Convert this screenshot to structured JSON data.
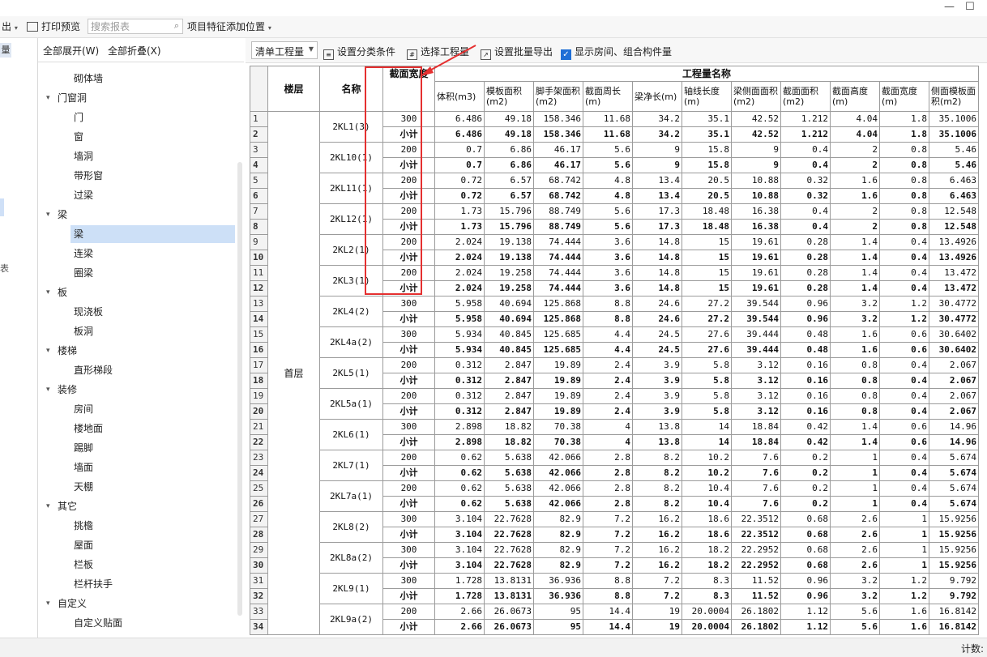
{
  "toolbar": {
    "export_label": "出",
    "print_preview_label": "打印预览",
    "search_placeholder": "搜索报表",
    "feature_position_label": "项目特征添加位置"
  },
  "left_strip": {
    "label": "量",
    "tiny": "表"
  },
  "tree_panel": {
    "expand_all": "全部展开(W)",
    "collapse_all": "全部折叠(X)",
    "items": [
      {
        "label": "砌体墙",
        "level": 2
      },
      {
        "label": "门窗洞",
        "level": 1
      },
      {
        "label": "门",
        "level": 2
      },
      {
        "label": "窗",
        "level": 2
      },
      {
        "label": "墙洞",
        "level": 2
      },
      {
        "label": "带形窗",
        "level": 2
      },
      {
        "label": "过梁",
        "level": 2
      },
      {
        "label": "梁",
        "level": 1
      },
      {
        "label": "梁",
        "level": 2,
        "selected": true
      },
      {
        "label": "连梁",
        "level": 2
      },
      {
        "label": "圈梁",
        "level": 2
      },
      {
        "label": "板",
        "level": 1
      },
      {
        "label": "现浇板",
        "level": 2
      },
      {
        "label": "板洞",
        "level": 2
      },
      {
        "label": "楼梯",
        "level": 1
      },
      {
        "label": "直形梯段",
        "level": 2
      },
      {
        "label": "装修",
        "level": 1
      },
      {
        "label": "房间",
        "level": 2
      },
      {
        "label": "楼地面",
        "level": 2
      },
      {
        "label": "踢脚",
        "level": 2
      },
      {
        "label": "墙面",
        "level": 2
      },
      {
        "label": "天棚",
        "level": 2
      },
      {
        "label": "其它",
        "level": 1
      },
      {
        "label": "挑檐",
        "level": 2
      },
      {
        "label": "屋面",
        "level": 2
      },
      {
        "label": "栏板",
        "level": 2
      },
      {
        "label": "栏杆扶手",
        "level": 2
      },
      {
        "label": "自定义",
        "level": 1
      },
      {
        "label": "自定义贴面",
        "level": 2
      }
    ]
  },
  "report_toolbar": {
    "mode": "清单工程量",
    "set_category": "设置分类条件",
    "select_quantity": "选择工程量",
    "set_batch_export": "设置批量导出",
    "show_room": "显示房间、组合构件量"
  },
  "table": {
    "header_group": "工程量名称",
    "col_floor": "楼层",
    "col_name": "名称",
    "col_width": "截面宽度",
    "quantity_columns": [
      "体积(m3)",
      "模板面积(m2)",
      "脚手架面积(m2)",
      "截面周长(m)",
      "梁净长(m)",
      "轴线长度(m)",
      "梁侧面面积(m2)",
      "截面面积(m2)",
      "截面高度(m)",
      "截面宽度(m)",
      "侧面模板面积(m2)"
    ],
    "floor": "首层",
    "subtotal_label": "小计",
    "groups": [
      {
        "name": "2KL1(3)",
        "width": "300",
        "values": [
          "6.486",
          "49.18",
          "158.346",
          "11.68",
          "34.2",
          "35.1",
          "42.52",
          "1.212",
          "4.04",
          "1.8",
          "35.1006"
        ]
      },
      {
        "name": "2KL10(1)",
        "width": "200",
        "values": [
          "0.7",
          "6.86",
          "46.17",
          "5.6",
          "9",
          "15.8",
          "9",
          "0.4",
          "2",
          "0.8",
          "5.46"
        ]
      },
      {
        "name": "2KL11(1)",
        "width": "200",
        "values": [
          "0.72",
          "6.57",
          "68.742",
          "4.8",
          "13.4",
          "20.5",
          "10.88",
          "0.32",
          "1.6",
          "0.8",
          "6.463"
        ]
      },
      {
        "name": "2KL12(1)",
        "width": "200",
        "values": [
          "1.73",
          "15.796",
          "88.749",
          "5.6",
          "17.3",
          "18.48",
          "16.38",
          "0.4",
          "2",
          "0.8",
          "12.548"
        ]
      },
      {
        "name": "2KL2(1)",
        "width": "200",
        "values": [
          "2.024",
          "19.138",
          "74.444",
          "3.6",
          "14.8",
          "15",
          "19.61",
          "0.28",
          "1.4",
          "0.4",
          "13.4926"
        ]
      },
      {
        "name": "2KL3(1)",
        "width": "200",
        "values": [
          "2.024",
          "19.258",
          "74.444",
          "3.6",
          "14.8",
          "15",
          "19.61",
          "0.28",
          "1.4",
          "0.4",
          "13.472"
        ]
      },
      {
        "name": "2KL4(2)",
        "width": "300",
        "values": [
          "5.958",
          "40.694",
          "125.868",
          "8.8",
          "24.6",
          "27.2",
          "39.544",
          "0.96",
          "3.2",
          "1.2",
          "30.4772"
        ]
      },
      {
        "name": "2KL4a(2)",
        "width": "300",
        "values": [
          "5.934",
          "40.845",
          "125.685",
          "4.4",
          "24.5",
          "27.6",
          "39.444",
          "0.48",
          "1.6",
          "0.6",
          "30.6402"
        ]
      },
      {
        "name": "2KL5(1)",
        "width": "200",
        "values": [
          "0.312",
          "2.847",
          "19.89",
          "2.4",
          "3.9",
          "5.8",
          "3.12",
          "0.16",
          "0.8",
          "0.4",
          "2.067"
        ]
      },
      {
        "name": "2KL5a(1)",
        "width": "200",
        "values": [
          "0.312",
          "2.847",
          "19.89",
          "2.4",
          "3.9",
          "5.8",
          "3.12",
          "0.16",
          "0.8",
          "0.4",
          "2.067"
        ]
      },
      {
        "name": "2KL6(1)",
        "width": "300",
        "values": [
          "2.898",
          "18.82",
          "70.38",
          "4",
          "13.8",
          "14",
          "18.84",
          "0.42",
          "1.4",
          "0.6",
          "14.96"
        ]
      },
      {
        "name": "2KL7(1)",
        "width": "200",
        "values": [
          "0.62",
          "5.638",
          "42.066",
          "2.8",
          "8.2",
          "10.2",
          "7.6",
          "0.2",
          "1",
          "0.4",
          "5.674"
        ]
      },
      {
        "name": "2KL7a(1)",
        "width": "200",
        "values": [
          "0.62",
          "5.638",
          "42.066",
          "2.8",
          "8.2",
          "10.4",
          "7.6",
          "0.2",
          "1",
          "0.4",
          "5.674"
        ]
      },
      {
        "name": "2KL8(2)",
        "width": "300",
        "values": [
          "3.104",
          "22.7628",
          "82.9",
          "7.2",
          "16.2",
          "18.6",
          "22.3512",
          "0.68",
          "2.6",
          "1",
          "15.9256"
        ]
      },
      {
        "name": "2KL8a(2)",
        "width": "300",
        "values": [
          "3.104",
          "22.7628",
          "82.9",
          "7.2",
          "16.2",
          "18.2",
          "22.2952",
          "0.68",
          "2.6",
          "1",
          "15.9256"
        ]
      },
      {
        "name": "2KL9(1)",
        "width": "300",
        "values": [
          "1.728",
          "13.8131",
          "36.936",
          "8.8",
          "7.2",
          "8.3",
          "11.52",
          "0.96",
          "3.2",
          "1.2",
          "9.792"
        ]
      },
      {
        "name": "2KL9a(2)",
        "width": "200",
        "values": [
          "2.66",
          "26.0673",
          "95",
          "14.4",
          "19",
          "20.0004",
          "26.1802",
          "1.12",
          "5.6",
          "1.6",
          "16.8142"
        ]
      }
    ]
  },
  "status": {
    "text": "计数:"
  },
  "colors": {
    "highlight": "#e53030",
    "selected": "#cde0f7"
  }
}
